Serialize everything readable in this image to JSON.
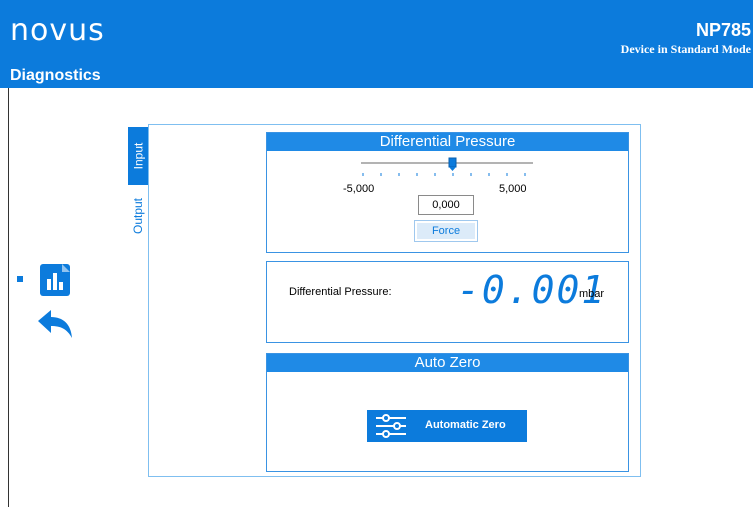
{
  "header": {
    "logo": "novus",
    "title": "Diagnostics",
    "model": "NP785",
    "mode": "Device in Standard Mode"
  },
  "sidebar": {
    "icons": [
      "chart-icon",
      "back-arrow-icon"
    ]
  },
  "tabs": {
    "input": "Input",
    "output": "Output",
    "active": "Input"
  },
  "differential_pressure_control": {
    "title": "Differential Pressure",
    "slider_min_label": "-5,000",
    "slider_max_label": "5,000",
    "slider_value": 0,
    "value": "0,000",
    "force_label": "Force"
  },
  "reading": {
    "label": "Differential Pressure:",
    "value": "-0.001",
    "unit": "mbar"
  },
  "auto_zero": {
    "title": "Auto Zero",
    "button_label": "Automatic Zero",
    "button_icon": "sliders-icon"
  },
  "colors": {
    "primary": "#0c7bdc",
    "card_header": "#1f8ae6",
    "border": "#7fbff0"
  }
}
